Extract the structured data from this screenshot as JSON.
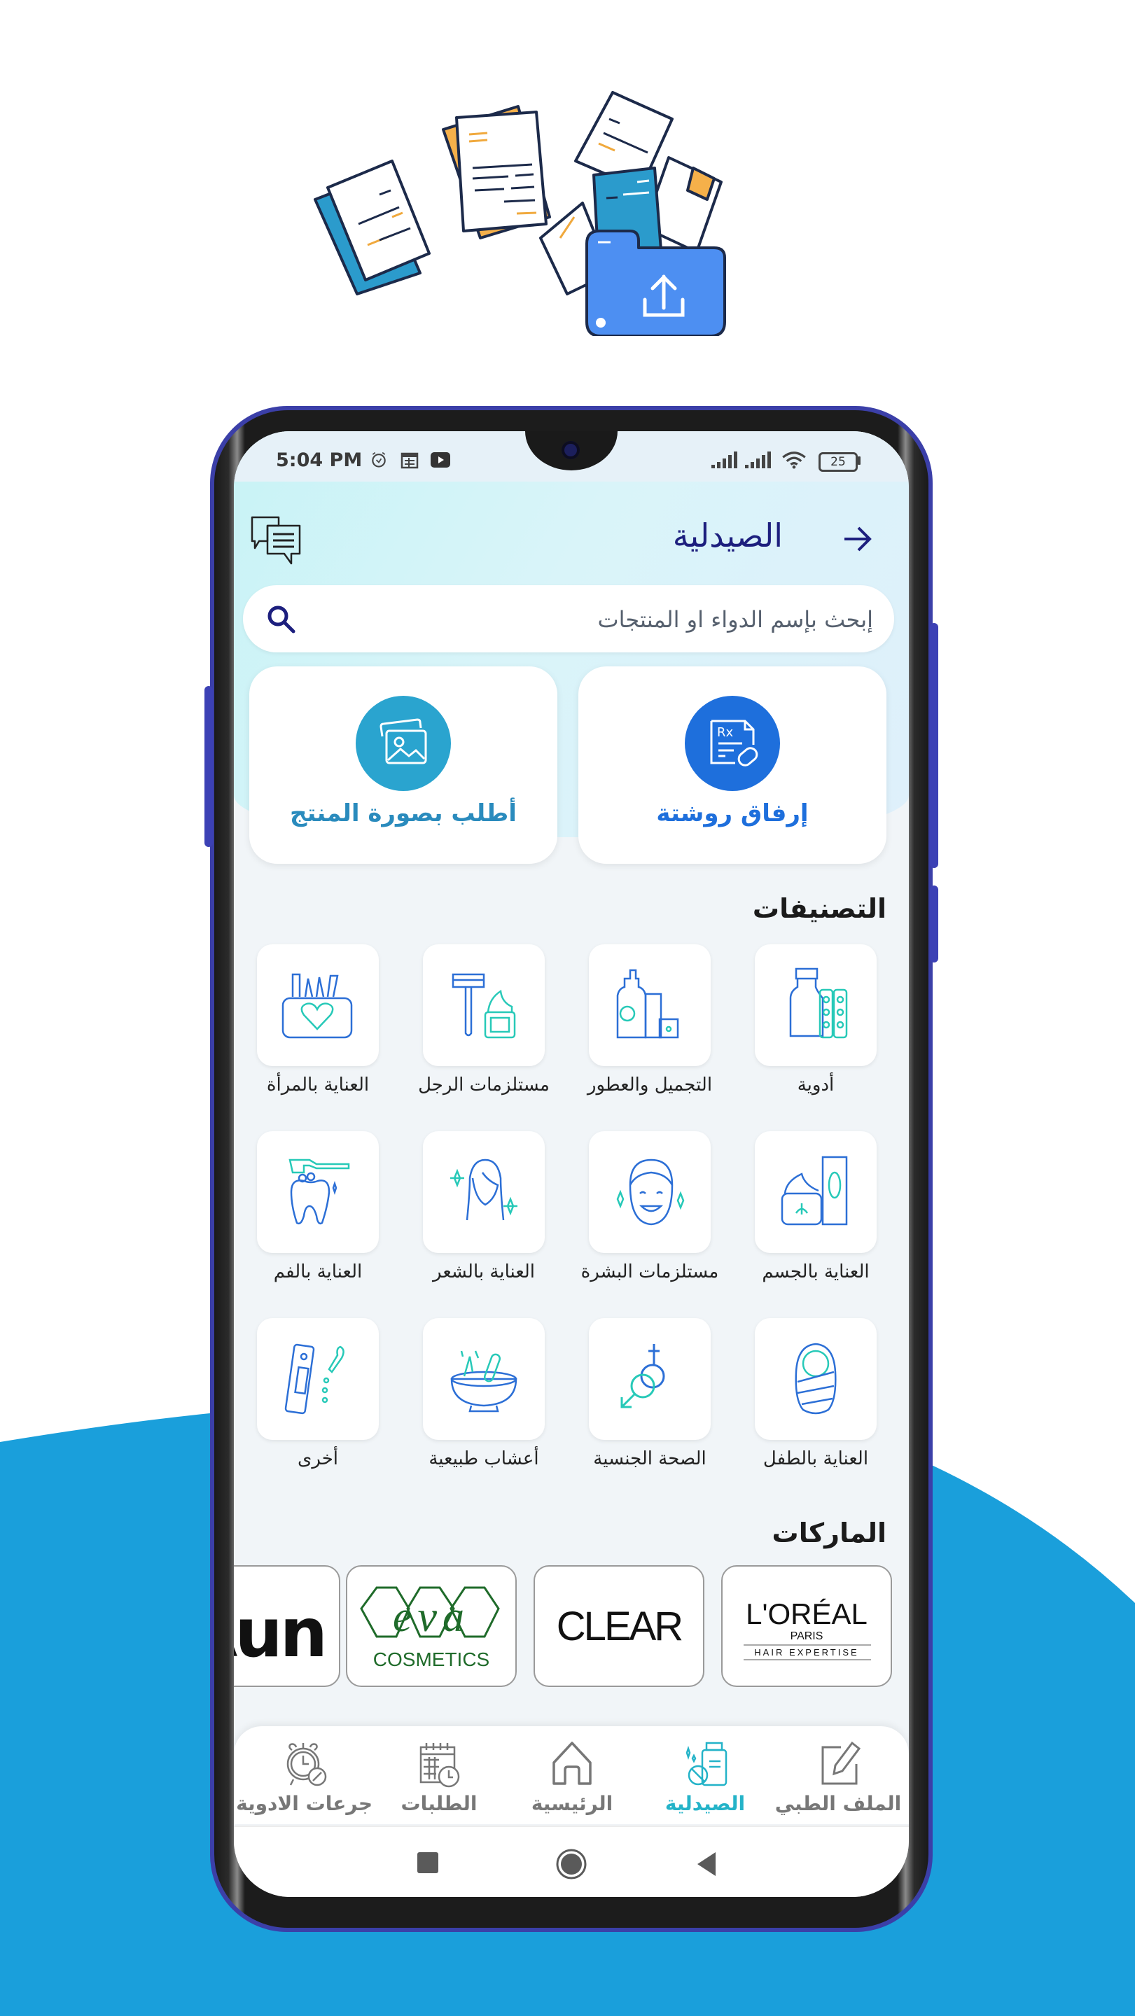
{
  "status_bar": {
    "time": "5:04 PM",
    "left_icons": [
      "alarm-icon",
      "calendar-icon",
      "media-play-icon"
    ],
    "right_icons": [
      "signal-icon",
      "signal-icon",
      "wifi-icon",
      "battery-icon"
    ],
    "battery": "25"
  },
  "header": {
    "title": "الصيدلية",
    "back_icon": "arrow-right-icon",
    "chat_icon": "chat-bubbles-icon"
  },
  "search": {
    "placeholder": "إبحث بإسم الدواء او المنتجات",
    "icon": "search-icon"
  },
  "actions": [
    {
      "label": "إرفاق روشتة",
      "icon": "prescription-icon",
      "color": "#1e6fdc"
    },
    {
      "label": "أطلب بصورة المنتج",
      "icon": "image-gallery-icon",
      "color": "#2aa4cf"
    }
  ],
  "categories_title": "التصنيفات",
  "categories": [
    {
      "label": "أدوية",
      "icon": "medicine-bottle-icon"
    },
    {
      "label": "التجميل والعطور",
      "icon": "cosmetics-bottles-icon"
    },
    {
      "label": "مستلزمات الرجل",
      "icon": "razor-icon"
    },
    {
      "label": "العناية بالمرأة",
      "icon": "makeup-bag-icon"
    },
    {
      "label": "العناية بالجسم",
      "icon": "body-cream-icon"
    },
    {
      "label": "مستلزمات البشرة",
      "icon": "face-towel-icon"
    },
    {
      "label": "العناية بالشعر",
      "icon": "hair-woman-icon"
    },
    {
      "label": "العناية بالفم",
      "icon": "tooth-brush-icon"
    },
    {
      "label": "العناية بالطفل",
      "icon": "baby-icon"
    },
    {
      "label": "الصحة الجنسية",
      "icon": "gender-symbols-icon"
    },
    {
      "label": "أعشاب طبيعية",
      "icon": "mortar-herbs-icon"
    },
    {
      "label": "أخرى",
      "icon": "test-dropper-icon"
    }
  ],
  "brands_title": "الماركات",
  "brands": [
    {
      "name": "L'ORÉAL",
      "sub1": "PARIS",
      "sub2": "HAIR EXPERTISE"
    },
    {
      "name": "CLEAR"
    },
    {
      "name": "EVA",
      "sub1": "COSMETICS",
      "color": "#1f6b2a"
    },
    {
      "name": "Aun"
    }
  ],
  "bottom_nav": [
    {
      "label": "الملف الطبي",
      "icon": "edit-file-icon",
      "active": false
    },
    {
      "label": "الصيدلية",
      "icon": "pharmacy-icon",
      "active": true
    },
    {
      "label": "الرئيسية",
      "icon": "home-icon",
      "active": false
    },
    {
      "label": "الطلبات",
      "icon": "calendar-clock-icon",
      "active": false
    },
    {
      "label": "جرعات الادوية",
      "icon": "alarm-pill-icon",
      "active": false
    }
  ],
  "system_nav": [
    "recent-apps-icon",
    "home-circle-icon",
    "back-triangle-icon"
  ],
  "colors": {
    "accent_teal": "#24b3c8",
    "title_navy": "#1d1f7e",
    "bg_blue": "#1a9fdb",
    "frame_purple": "#3b3fa8"
  }
}
